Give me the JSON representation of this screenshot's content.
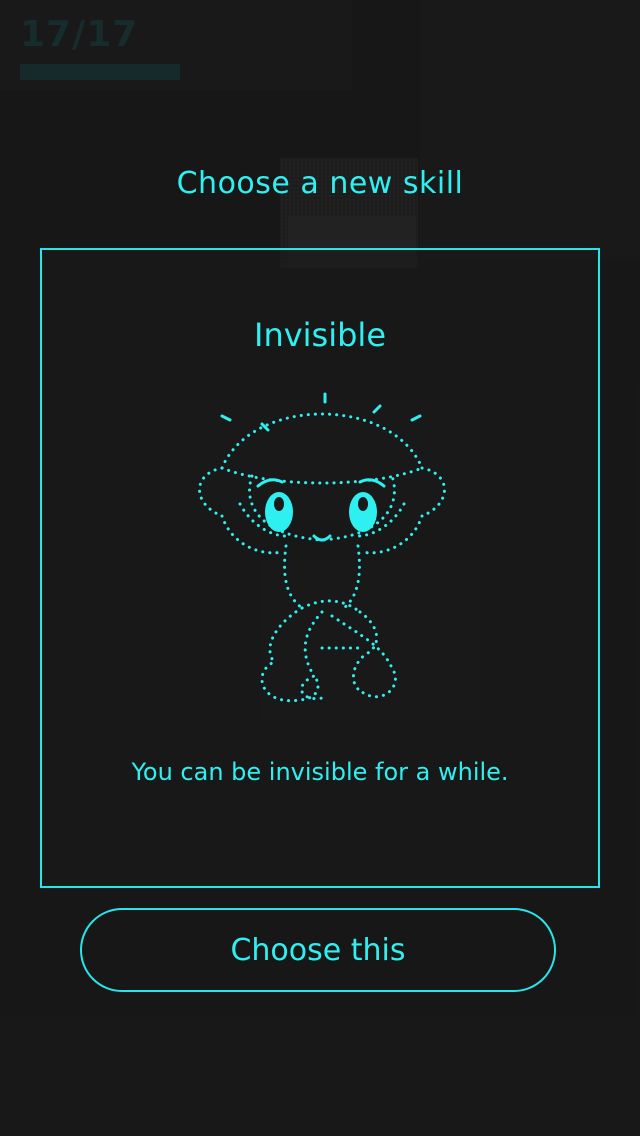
{
  "hud": {
    "level_counter": "17/17"
  },
  "dialog": {
    "title": "Choose a new skill",
    "skill": {
      "name": "Invisible",
      "description": "You can be invisible for a while.",
      "icon": "dotted-invisible-creature-icon"
    },
    "choose_button_label": "Choose this"
  },
  "colors": {
    "accent": "#2ff0f0",
    "background": "#1a1a1a",
    "hud_dim": "#173638"
  }
}
